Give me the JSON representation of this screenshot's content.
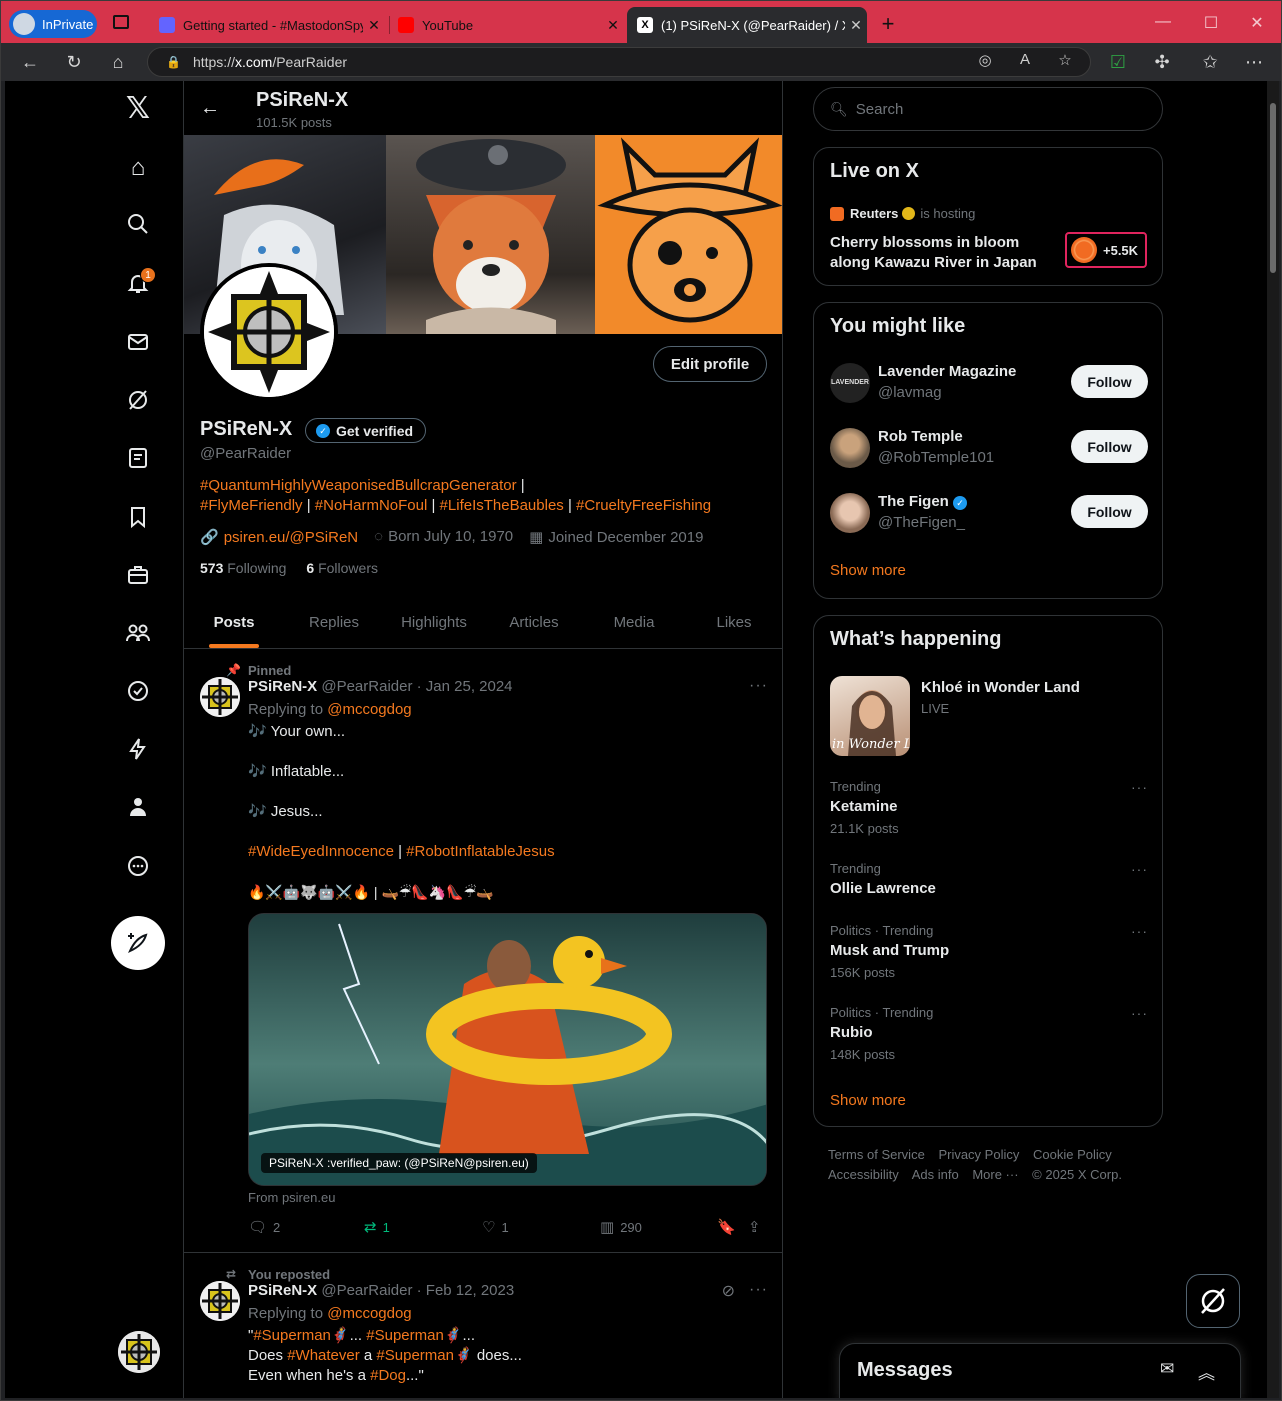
{
  "browser": {
    "inprivate_label": "InPrivate",
    "tabs": [
      {
        "title": "Getting started - #MastodonSpy",
        "favicon_color": "#6364ff"
      },
      {
        "title": "YouTube",
        "favicon_color": "#ff0000"
      },
      {
        "title": "(1) PSiReN-X (@PearRaider) / X",
        "favicon_color": "#ffffff"
      }
    ],
    "url_prefix": "https://",
    "url_host": "x.com",
    "url_path": "/PearRaider"
  },
  "nav": {
    "notification_count": "1"
  },
  "header": {
    "name": "PSiReN-X",
    "post_count": "101.5K posts"
  },
  "profile": {
    "edit_label": "Edit profile",
    "name": "PSiReN-X",
    "get_verified": "Get verified",
    "handle": "@PearRaider",
    "bio": {
      "t1": "#QuantumHighlyWeaponisedBullcrapGenerator",
      "s1": " | ",
      "t2": "#FlyMeFriendly",
      "s2": " | ",
      "t3": "#NoHarmNoFoul",
      "s3": " | ",
      "t4": "#LifeIsTheBaubles",
      "s4": " | ",
      "t5": "#CrueltyFreeFishing"
    },
    "website": "psiren.eu/@PSiReN",
    "born": "Born July 10, 1970",
    "joined": "Joined December 2019",
    "following_count": "573",
    "following_label": "Following",
    "followers_count": "6",
    "followers_label": "Followers"
  },
  "tabs": [
    "Posts",
    "Replies",
    "Highlights",
    "Articles",
    "Media",
    "Likes"
  ],
  "posts": [
    {
      "context": "Pinned",
      "name": "PSiReN-X",
      "meta": "@PearRaider · Jan 25, 2024",
      "replying_prefix": "Replying to ",
      "replying_to": "@mccogdog",
      "lines": [
        "🎶 Your own...",
        "🎶 Inflatable...",
        "🎶 Jesus..."
      ],
      "tag1": "#WideEyedInnocence",
      "tag_sep": " | ",
      "tag2": "#RobotInflatableJesus",
      "emoji_line": "🔥⚔️🤖🐺🤖⚔️🔥 | 🛶☔👠🦄👠☔🛶",
      "media_caption": "PSiReN-X :verified_paw: (@PSiReN@psiren.eu)",
      "from": "From psiren.eu",
      "replies": "2",
      "reposts": "1",
      "likes": "1",
      "views": "290"
    },
    {
      "context": "You reposted",
      "name": "PSiReN-X",
      "meta": "@PearRaider · Feb 12, 2023",
      "replying_prefix": "Replying to ",
      "replying_to": "@mccogdog",
      "l1_a": "\"",
      "l1_b": "#Superman",
      "l1_c": "🦸... ",
      "l1_d": "#Superman",
      "l1_e": "🦸...",
      "l2_a": "Does ",
      "l2_b": "#Whatever",
      "l2_c": " a ",
      "l2_d": "#Superman",
      "l2_e": "🦸 does...",
      "l3_a": "Even when he's a ",
      "l3_b": "#Dog",
      "l3_c": "...\""
    }
  ],
  "search": {
    "placeholder": "Search"
  },
  "live": {
    "title": "Live on X",
    "host": "Reuters",
    "hosting": "is hosting",
    "event": "Cherry blossoms in bloom along Kawazu River in Japan",
    "listeners": "+5.5K"
  },
  "wtf": {
    "title": "You might like",
    "users": [
      {
        "name": "Lavender Magazine",
        "handle": "@lavmag",
        "avatar_text": "LAVENDER"
      },
      {
        "name": "Rob Temple",
        "handle": "@RobTemple101",
        "avatar_text": ""
      },
      {
        "name": "The Figen",
        "handle": "@TheFigen_",
        "avatar_text": ""
      }
    ],
    "follow_label": "Follow",
    "show_more": "Show more"
  },
  "happening": {
    "title": "What’s happening",
    "feature": {
      "name": "Khloé in Wonder Land",
      "status": "LIVE",
      "thumb_text": "in Wonder L"
    },
    "trends": [
      {
        "category": "Trending",
        "name": "Ketamine",
        "count": "21.1K posts"
      },
      {
        "category": "Trending",
        "name": "Ollie Lawrence",
        "count": ""
      },
      {
        "category": "Politics · Trending",
        "name": "Musk and Trump",
        "count": "156K posts"
      },
      {
        "category": "Politics · Trending",
        "name": "Rubio",
        "count": "148K posts"
      }
    ],
    "show_more": "Show more"
  },
  "footer": {
    "links": [
      "Terms of Service",
      "Privacy Policy",
      "Cookie Policy",
      "Accessibility",
      "Ads info",
      "More ···",
      "© 2025 X Corp."
    ]
  },
  "messages": {
    "title": "Messages"
  },
  "colors": {
    "accent": "#f4791f",
    "verified": "#1d9bf0",
    "live_border": "#e0245e"
  }
}
